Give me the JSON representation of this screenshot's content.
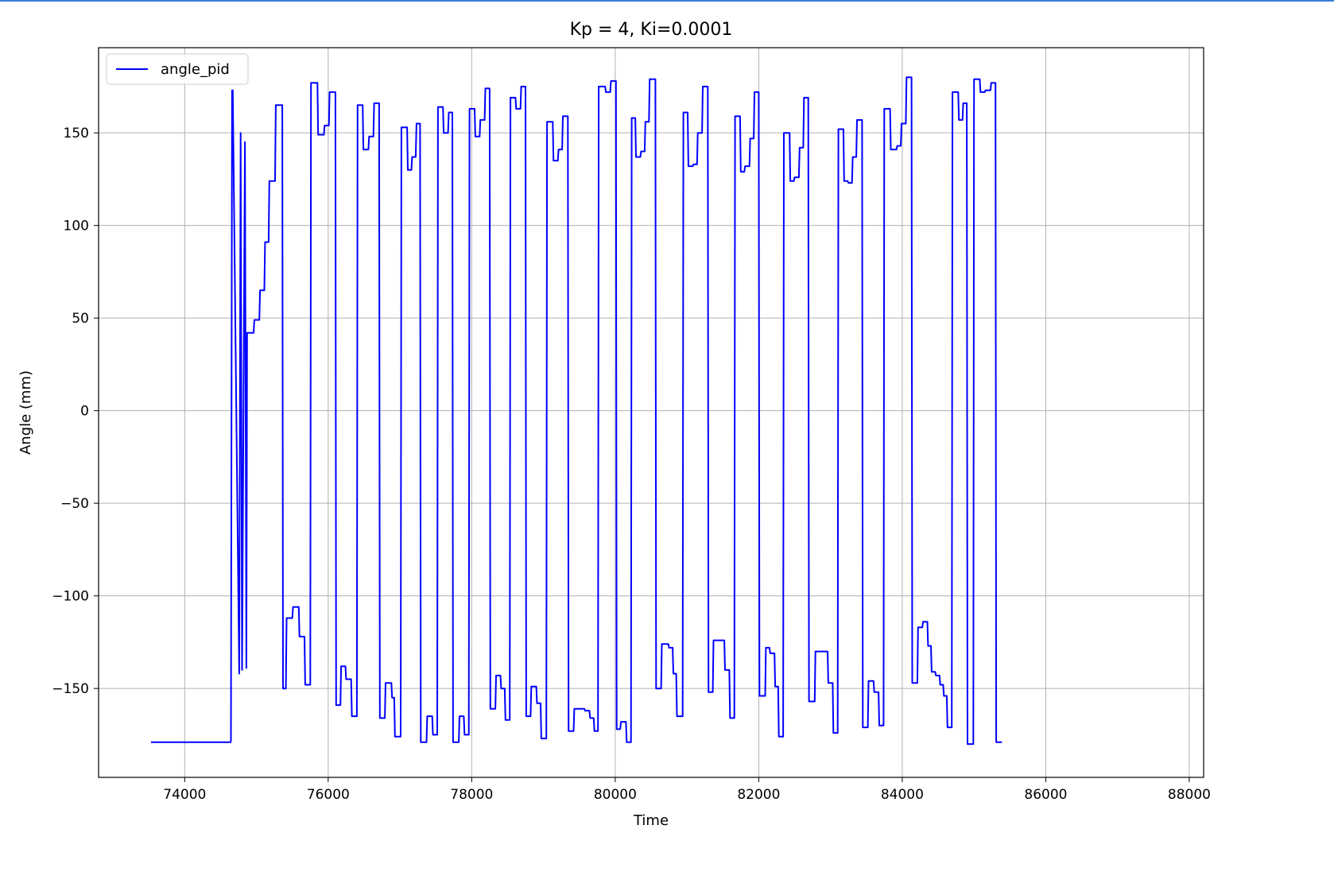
{
  "chart_data": {
    "type": "line",
    "title": "Kp = 4, Ki=0.0001",
    "xlabel": "Time",
    "ylabel": "Angle (mm)",
    "xlim": [
      72800,
      88200
    ],
    "ylim": [
      -198,
      196
    ],
    "xticks": [
      74000,
      76000,
      78000,
      80000,
      82000,
      84000,
      86000,
      88000
    ],
    "xtick_labels": [
      "74000",
      "76000",
      "78000",
      "80000",
      "82000",
      "84000",
      "86000",
      "88000"
    ],
    "yticks": [
      -150,
      -100,
      -50,
      0,
      50,
      100,
      150
    ],
    "ytick_labels": [
      "−150",
      "−100",
      "−50",
      "0",
      "50",
      "100",
      "150"
    ],
    "grid": true,
    "legend_position": "top-left",
    "series": [
      {
        "name": "angle_pid",
        "color": "#0000ff",
        "points": [
          [
            73530,
            -179
          ],
          [
            74640,
            -179
          ],
          [
            74645,
            -178
          ],
          [
            74660,
            173
          ],
          [
            74670,
            173
          ],
          [
            74760,
            -142
          ],
          [
            74780,
            150
          ],
          [
            74800,
            -140
          ],
          [
            74840,
            145
          ],
          [
            74860,
            -139
          ],
          [
            74870,
            42
          ],
          [
            74960,
            42
          ],
          [
            74970,
            49
          ],
          [
            75040,
            49
          ],
          [
            75050,
            65
          ],
          [
            75110,
            65
          ],
          [
            75120,
            91
          ],
          [
            75170,
            91
          ],
          [
            75180,
            124
          ],
          [
            75260,
            124
          ],
          [
            75270,
            165
          ],
          [
            75360,
            165
          ],
          [
            75370,
            -150
          ],
          [
            75410,
            -150
          ],
          [
            75420,
            -112
          ],
          [
            75500,
            -112
          ],
          [
            75510,
            -106
          ],
          [
            75590,
            -106
          ],
          [
            75600,
            -122
          ],
          [
            75670,
            -122
          ],
          [
            75680,
            -148
          ],
          [
            75750,
            -148
          ],
          [
            75760,
            177
          ],
          [
            75850,
            177
          ],
          [
            75860,
            149
          ],
          [
            75940,
            149
          ],
          [
            75950,
            154
          ],
          [
            76010,
            154
          ],
          [
            76020,
            172
          ],
          [
            76100,
            172
          ],
          [
            76110,
            -159
          ],
          [
            76170,
            -159
          ],
          [
            76180,
            -138
          ],
          [
            76240,
            -138
          ],
          [
            76250,
            -145
          ],
          [
            76320,
            -145
          ],
          [
            76330,
            -165
          ],
          [
            76400,
            -165
          ],
          [
            76410,
            165
          ],
          [
            76480,
            165
          ],
          [
            76490,
            141
          ],
          [
            76560,
            141
          ],
          [
            76570,
            148
          ],
          [
            76630,
            148
          ],
          [
            76640,
            166
          ],
          [
            76710,
            166
          ],
          [
            76720,
            -166
          ],
          [
            76790,
            -166
          ],
          [
            76800,
            -147
          ],
          [
            76880,
            -147
          ],
          [
            76890,
            -155
          ],
          [
            76920,
            -155
          ],
          [
            76930,
            -176
          ],
          [
            77010,
            -176
          ],
          [
            77020,
            153
          ],
          [
            77100,
            153
          ],
          [
            77110,
            130
          ],
          [
            77160,
            130
          ],
          [
            77170,
            137
          ],
          [
            77220,
            137
          ],
          [
            77230,
            155
          ],
          [
            77280,
            155
          ],
          [
            77290,
            -179
          ],
          [
            77370,
            -179
          ],
          [
            77380,
            -165
          ],
          [
            77450,
            -165
          ],
          [
            77460,
            -175
          ],
          [
            77520,
            -175
          ],
          [
            77530,
            164
          ],
          [
            77600,
            164
          ],
          [
            77610,
            150
          ],
          [
            77670,
            150
          ],
          [
            77680,
            161
          ],
          [
            77730,
            161
          ],
          [
            77740,
            -179
          ],
          [
            77820,
            -179
          ],
          [
            77830,
            -165
          ],
          [
            77890,
            -165
          ],
          [
            77900,
            -175
          ],
          [
            77960,
            -175
          ],
          [
            77970,
            163
          ],
          [
            78040,
            163
          ],
          [
            78050,
            148
          ],
          [
            78110,
            148
          ],
          [
            78120,
            157
          ],
          [
            78180,
            157
          ],
          [
            78190,
            174
          ],
          [
            78250,
            174
          ],
          [
            78260,
            -161
          ],
          [
            78330,
            -161
          ],
          [
            78340,
            -143
          ],
          [
            78400,
            -143
          ],
          [
            78410,
            -150
          ],
          [
            78460,
            -150
          ],
          [
            78470,
            -167
          ],
          [
            78530,
            -167
          ],
          [
            78540,
            169
          ],
          [
            78610,
            169
          ],
          [
            78620,
            163
          ],
          [
            78680,
            163
          ],
          [
            78690,
            175
          ],
          [
            78750,
            175
          ],
          [
            78760,
            -165
          ],
          [
            78820,
            -165
          ],
          [
            78830,
            -149
          ],
          [
            78900,
            -149
          ],
          [
            78910,
            -158
          ],
          [
            78960,
            -158
          ],
          [
            78970,
            -177
          ],
          [
            79040,
            -177
          ],
          [
            79050,
            156
          ],
          [
            79130,
            156
          ],
          [
            79140,
            135
          ],
          [
            79200,
            135
          ],
          [
            79210,
            141
          ],
          [
            79260,
            141
          ],
          [
            79270,
            159
          ],
          [
            79340,
            159
          ],
          [
            79350,
            -173
          ],
          [
            79420,
            -173
          ],
          [
            79430,
            -161
          ],
          [
            79570,
            -161
          ],
          [
            79580,
            -162
          ],
          [
            79640,
            -162
          ],
          [
            79650,
            -166
          ],
          [
            79700,
            -166
          ],
          [
            79710,
            -173
          ],
          [
            79760,
            -173
          ],
          [
            79770,
            175
          ],
          [
            79860,
            175
          ],
          [
            79870,
            172
          ],
          [
            79930,
            172
          ],
          [
            79940,
            178
          ],
          [
            80010,
            178
          ],
          [
            80020,
            -172
          ],
          [
            80070,
            -172
          ],
          [
            80080,
            -168
          ],
          [
            80150,
            -168
          ],
          [
            80160,
            -179
          ],
          [
            80220,
            -179
          ],
          [
            80230,
            158
          ],
          [
            80280,
            158
          ],
          [
            80290,
            137
          ],
          [
            80350,
            137
          ],
          [
            80360,
            140
          ],
          [
            80410,
            140
          ],
          [
            80420,
            156
          ],
          [
            80470,
            156
          ],
          [
            80480,
            179
          ],
          [
            80560,
            179
          ],
          [
            80570,
            -150
          ],
          [
            80640,
            -150
          ],
          [
            80650,
            -126
          ],
          [
            80740,
            -126
          ],
          [
            80750,
            -128
          ],
          [
            80800,
            -128
          ],
          [
            80810,
            -142
          ],
          [
            80850,
            -142
          ],
          [
            80860,
            -165
          ],
          [
            80940,
            -165
          ],
          [
            80950,
            161
          ],
          [
            81010,
            161
          ],
          [
            81020,
            132
          ],
          [
            81080,
            132
          ],
          [
            81090,
            133
          ],
          [
            81140,
            133
          ],
          [
            81150,
            150
          ],
          [
            81210,
            150
          ],
          [
            81220,
            175
          ],
          [
            81290,
            175
          ],
          [
            81300,
            -152
          ],
          [
            81360,
            -152
          ],
          [
            81370,
            -124
          ],
          [
            81520,
            -124
          ],
          [
            81530,
            -140
          ],
          [
            81590,
            -140
          ],
          [
            81600,
            -166
          ],
          [
            81660,
            -166
          ],
          [
            81670,
            159
          ],
          [
            81740,
            159
          ],
          [
            81750,
            129
          ],
          [
            81800,
            129
          ],
          [
            81810,
            132
          ],
          [
            81870,
            132
          ],
          [
            81880,
            147
          ],
          [
            81930,
            147
          ],
          [
            81940,
            172
          ],
          [
            82000,
            172
          ],
          [
            82010,
            -154
          ],
          [
            82090,
            -154
          ],
          [
            82100,
            -128
          ],
          [
            82150,
            -128
          ],
          [
            82160,
            -131
          ],
          [
            82220,
            -131
          ],
          [
            82230,
            -149
          ],
          [
            82270,
            -149
          ],
          [
            82280,
            -176
          ],
          [
            82340,
            -176
          ],
          [
            82350,
            150
          ],
          [
            82430,
            150
          ],
          [
            82440,
            124
          ],
          [
            82490,
            124
          ],
          [
            82500,
            126
          ],
          [
            82560,
            126
          ],
          [
            82570,
            142
          ],
          [
            82620,
            142
          ],
          [
            82630,
            169
          ],
          [
            82690,
            169
          ],
          [
            82700,
            -157
          ],
          [
            82780,
            -157
          ],
          [
            82790,
            -130
          ],
          [
            82960,
            -130
          ],
          [
            82970,
            -147
          ],
          [
            83030,
            -147
          ],
          [
            83040,
            -174
          ],
          [
            83100,
            -174
          ],
          [
            83110,
            152
          ],
          [
            83180,
            152
          ],
          [
            83190,
            124
          ],
          [
            83240,
            124
          ],
          [
            83250,
            123
          ],
          [
            83300,
            123
          ],
          [
            83310,
            137
          ],
          [
            83360,
            137
          ],
          [
            83370,
            157
          ],
          [
            83440,
            157
          ],
          [
            83450,
            -171
          ],
          [
            83520,
            -171
          ],
          [
            83530,
            -146
          ],
          [
            83600,
            -146
          ],
          [
            83610,
            -152
          ],
          [
            83670,
            -152
          ],
          [
            83680,
            -170
          ],
          [
            83740,
            -170
          ],
          [
            83750,
            163
          ],
          [
            83830,
            163
          ],
          [
            83840,
            141
          ],
          [
            83920,
            141
          ],
          [
            83930,
            143
          ],
          [
            83980,
            143
          ],
          [
            83990,
            155
          ],
          [
            84050,
            155
          ],
          [
            84060,
            180
          ],
          [
            84130,
            180
          ],
          [
            84140,
            -147
          ],
          [
            84210,
            -147
          ],
          [
            84220,
            -117
          ],
          [
            84280,
            -117
          ],
          [
            84290,
            -114
          ],
          [
            84350,
            -114
          ],
          [
            84360,
            -127
          ],
          [
            84400,
            -127
          ],
          [
            84410,
            -141
          ],
          [
            84460,
            -141
          ],
          [
            84470,
            -143
          ],
          [
            84520,
            -143
          ],
          [
            84530,
            -148
          ],
          [
            84570,
            -148
          ],
          [
            84580,
            -154
          ],
          [
            84620,
            -154
          ],
          [
            84630,
            -171
          ],
          [
            84690,
            -171
          ],
          [
            84700,
            172
          ],
          [
            84780,
            172
          ],
          [
            84790,
            157
          ],
          [
            84840,
            157
          ],
          [
            84850,
            166
          ],
          [
            84900,
            166
          ],
          [
            84910,
            -180
          ],
          [
            84990,
            -180
          ],
          [
            85000,
            179
          ],
          [
            85080,
            179
          ],
          [
            85090,
            172
          ],
          [
            85150,
            172
          ],
          [
            85160,
            173
          ],
          [
            85230,
            173
          ],
          [
            85240,
            177
          ],
          [
            85300,
            177
          ],
          [
            85310,
            -179
          ],
          [
            85390,
            -179
          ]
        ]
      }
    ]
  }
}
